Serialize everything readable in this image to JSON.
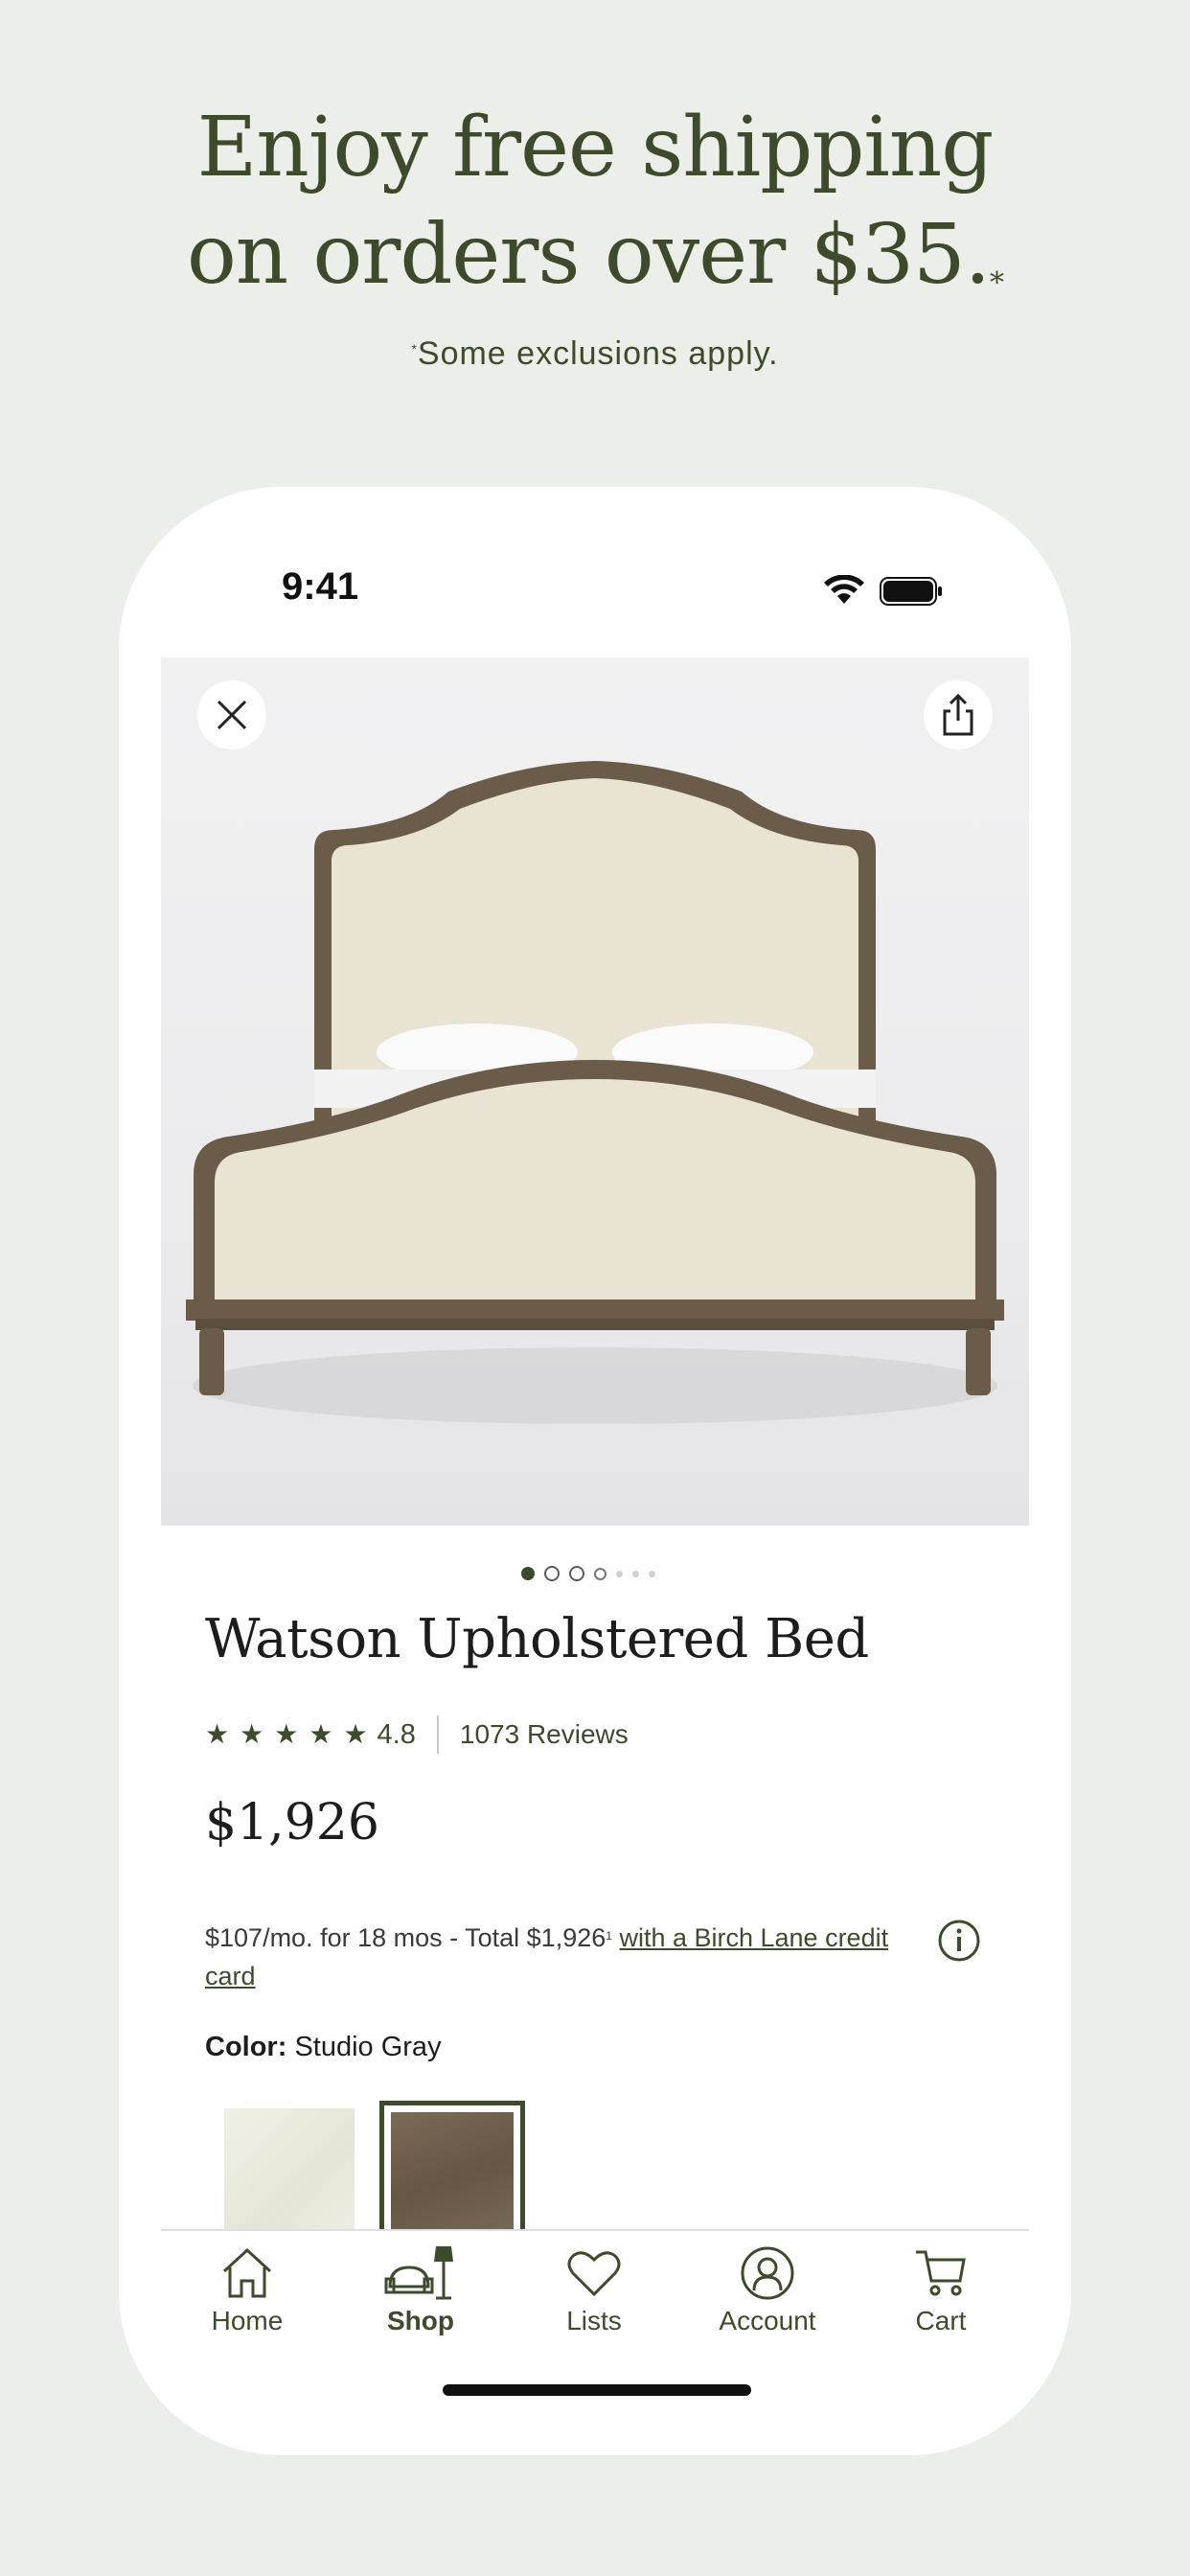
{
  "promo": {
    "line1": "Enjoy free shipping",
    "line2": "on orders over $35.",
    "line2_mark": "*",
    "note_mark": "*",
    "note": "Some exclusions apply."
  },
  "status_bar": {
    "time": "9:41"
  },
  "product": {
    "title": "Watson Upholstered Bed",
    "rating": "4.8",
    "stars": 5,
    "reviews": "1073 Reviews",
    "price": "$1,926",
    "finance_text": "$107/mo. for 18 mos - Total $1,926",
    "finance_mark": "1",
    "finance_link": "with a Birch Lane credit card",
    "color_label": "Color:",
    "color_value": "Studio Gray",
    "image_count": 7,
    "image_index": 1
  },
  "tabs": [
    {
      "label": "Home",
      "icon": "house-icon"
    },
    {
      "label": "Shop",
      "icon": "chair-lamp-icon"
    },
    {
      "label": "Lists",
      "icon": "heart-icon"
    },
    {
      "label": "Account",
      "icon": "person-icon"
    },
    {
      "label": "Cart",
      "icon": "cart-icon"
    }
  ],
  "colors": {
    "brand": "#3e4a2c",
    "background": "#eceeea"
  }
}
